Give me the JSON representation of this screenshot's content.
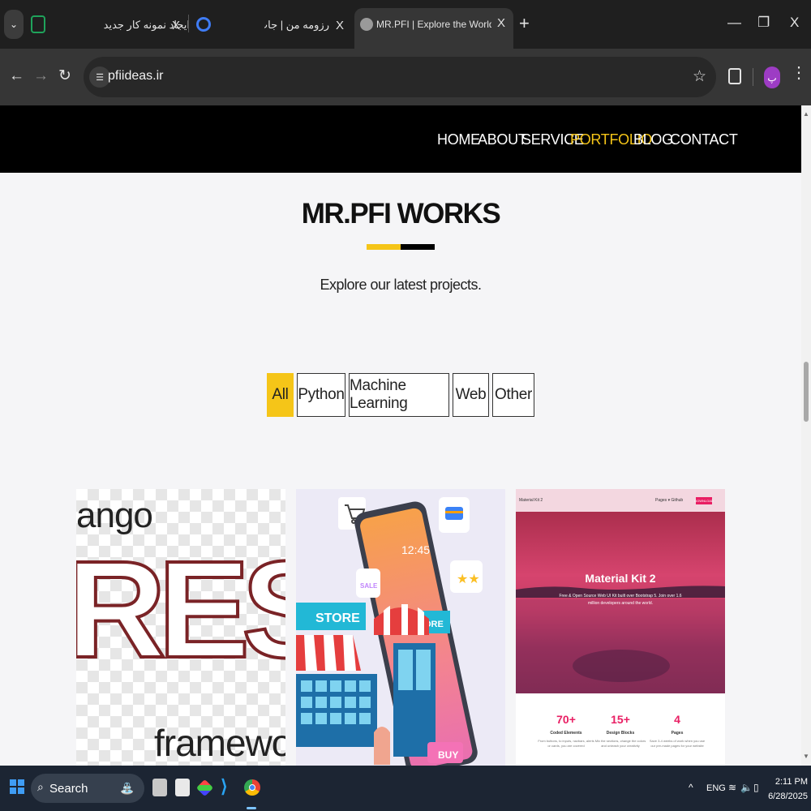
{
  "browser": {
    "tabs": [
      {
        "title": "ایجاد نمونه کار جدید",
        "close": "X"
      },
      {
        "title": "رزومه من | جاب‌ویژن",
        "close": "X"
      },
      {
        "title": "MR.PFI | Explore the World together",
        "close": "X",
        "active": true
      }
    ],
    "new_tab": "+",
    "window_controls": {
      "minimize": "—",
      "restore": "❐",
      "close": "X"
    },
    "url": "pfiideas.ir",
    "profile_initial": "پ"
  },
  "site": {
    "nav": [
      "HOME",
      "ABOUT",
      "SERVICE",
      "PORTFOLIO",
      "BLOG",
      "CONTACT"
    ],
    "nav_active": "PORTFOLIO",
    "section_title": "MR.PFI WORKS",
    "subtitle": "Explore our latest projects.",
    "filters": [
      "All",
      "Python",
      "Machine Learning",
      "Web",
      "Other"
    ],
    "filter_active": "All",
    "accent_color": "#f5c518",
    "cards": [
      {
        "top_text": "ango",
        "big_text": "REST",
        "bottom_text": "framewo"
      },
      {
        "store_sign": "STORE",
        "sale_tag": "SALE",
        "phone_time": "12:45",
        "buy_label": "BUY",
        "side_sign": "ORE"
      },
      {
        "brand": "Material Kit 2",
        "nav_text": "Pages ▾   Github",
        "nav_button": "DOWNLOAD",
        "title": "Material Kit 2",
        "subtitle": "Free & Open Source Web UI Kit built over Bootstrap 5. Join over 1.6 million developers around the world.",
        "stats": [
          {
            "value": "70+",
            "label": "Coded Elements",
            "desc": "From buttons, to inputs, navbars, alerts or cards, you are covered"
          },
          {
            "value": "15+",
            "label": "Design Blocks",
            "desc": "Mix the sections, change the colors and unleash your creativity"
          },
          {
            "value": "4",
            "label": "Pages",
            "desc": "Save 3-4 weeks of work when you use our pre-made pages for your website"
          }
        ]
      }
    ]
  },
  "taskbar": {
    "search_label": "Search",
    "language": "ENG",
    "time": "2:11 PM",
    "date": "6/28/2025"
  }
}
